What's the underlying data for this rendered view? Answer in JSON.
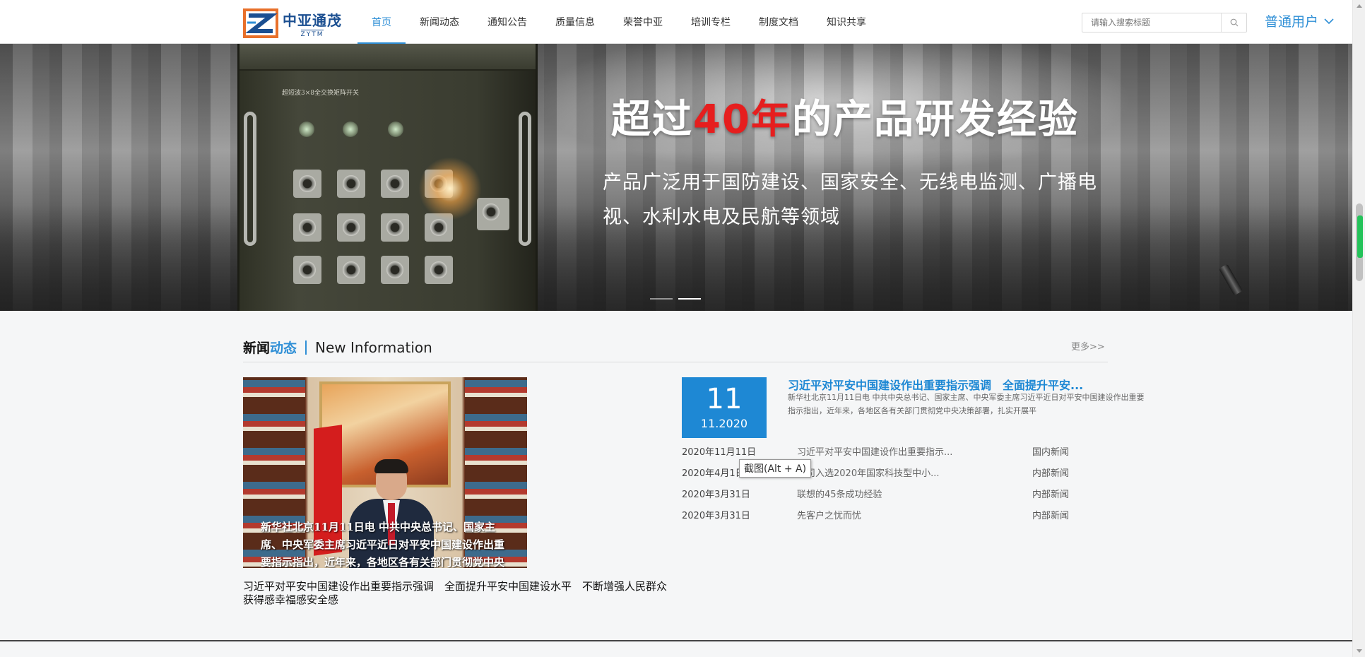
{
  "header": {
    "logo": {
      "cn": "中亚通茂",
      "en": "ZYTM"
    },
    "nav": [
      {
        "label": "首页",
        "active": true
      },
      {
        "label": "新闻动态",
        "active": false
      },
      {
        "label": "通知公告",
        "active": false
      },
      {
        "label": "质量信息",
        "active": false
      },
      {
        "label": "荣誉中亚",
        "active": false
      },
      {
        "label": "培训专栏",
        "active": false
      },
      {
        "label": "制度文档",
        "active": false
      },
      {
        "label": "知识共享",
        "active": false
      }
    ],
    "search": {
      "placeholder": "请输入搜索标题",
      "icon": "search-icon"
    },
    "user": {
      "label": "普通用户",
      "icon": "chevron-down-icon"
    }
  },
  "banner": {
    "headline_pre": "超过",
    "headline_accent": "40年",
    "headline_post": "的产品研发经验",
    "subline": "产品广泛用于国防建设、国家安全、无线电监测、广播电视、水利水电及民航等领域",
    "device_title": "超短波3×8全交换矩阵开关",
    "slide_count": 2,
    "active_slide": 2,
    "accent_color": "#e61e1e"
  },
  "news": {
    "title_part1": "新闻",
    "title_part2": "动态",
    "title_en": "New Information",
    "more_label": "更多>>",
    "photo_overlay": "新华社北京11月11日电 中共中央总书记、国家主席、中央军委主席习近平近日对平安中国建设作出重要指示指出，近年来，各地区各有关部门贯彻党中央",
    "photo_caption": "习近平对平安中国建设作出重要指示强调　全面提升平安中国建设水平　不断增强人民群众获得感幸福感安全感",
    "featured": {
      "day": "11",
      "year_month": "11.2020",
      "title": "习近平对平安中国建设作出重要指示强调　全面提升平安...",
      "description": "新华社北京11月11日电 中共中央总书记、国家主席、中央军委主席习近平近日对平安中国建设作出重要指示指出，近年来，各地区各有关部门贯彻党中央决策部署，扎实开展平"
    },
    "items": [
      {
        "date": "2020年11月11日",
        "title": "习近平对平安中国建设作出重要指示...",
        "category": "国内新闻"
      },
      {
        "date": "2020年4月1日",
        "title": "公司入选2020年国家科技型中小...",
        "category": "内部新闻"
      },
      {
        "date": "2020年3月31日",
        "title": "联想的45条成功经验",
        "category": "内部新闻"
      },
      {
        "date": "2020年3月31日",
        "title": "先客户之忧而忧",
        "category": "内部新闻"
      }
    ]
  },
  "tooltip": "截图(Alt + A)",
  "colors": {
    "primary": "#2f8fd6",
    "date_box": "#1e88d4"
  }
}
